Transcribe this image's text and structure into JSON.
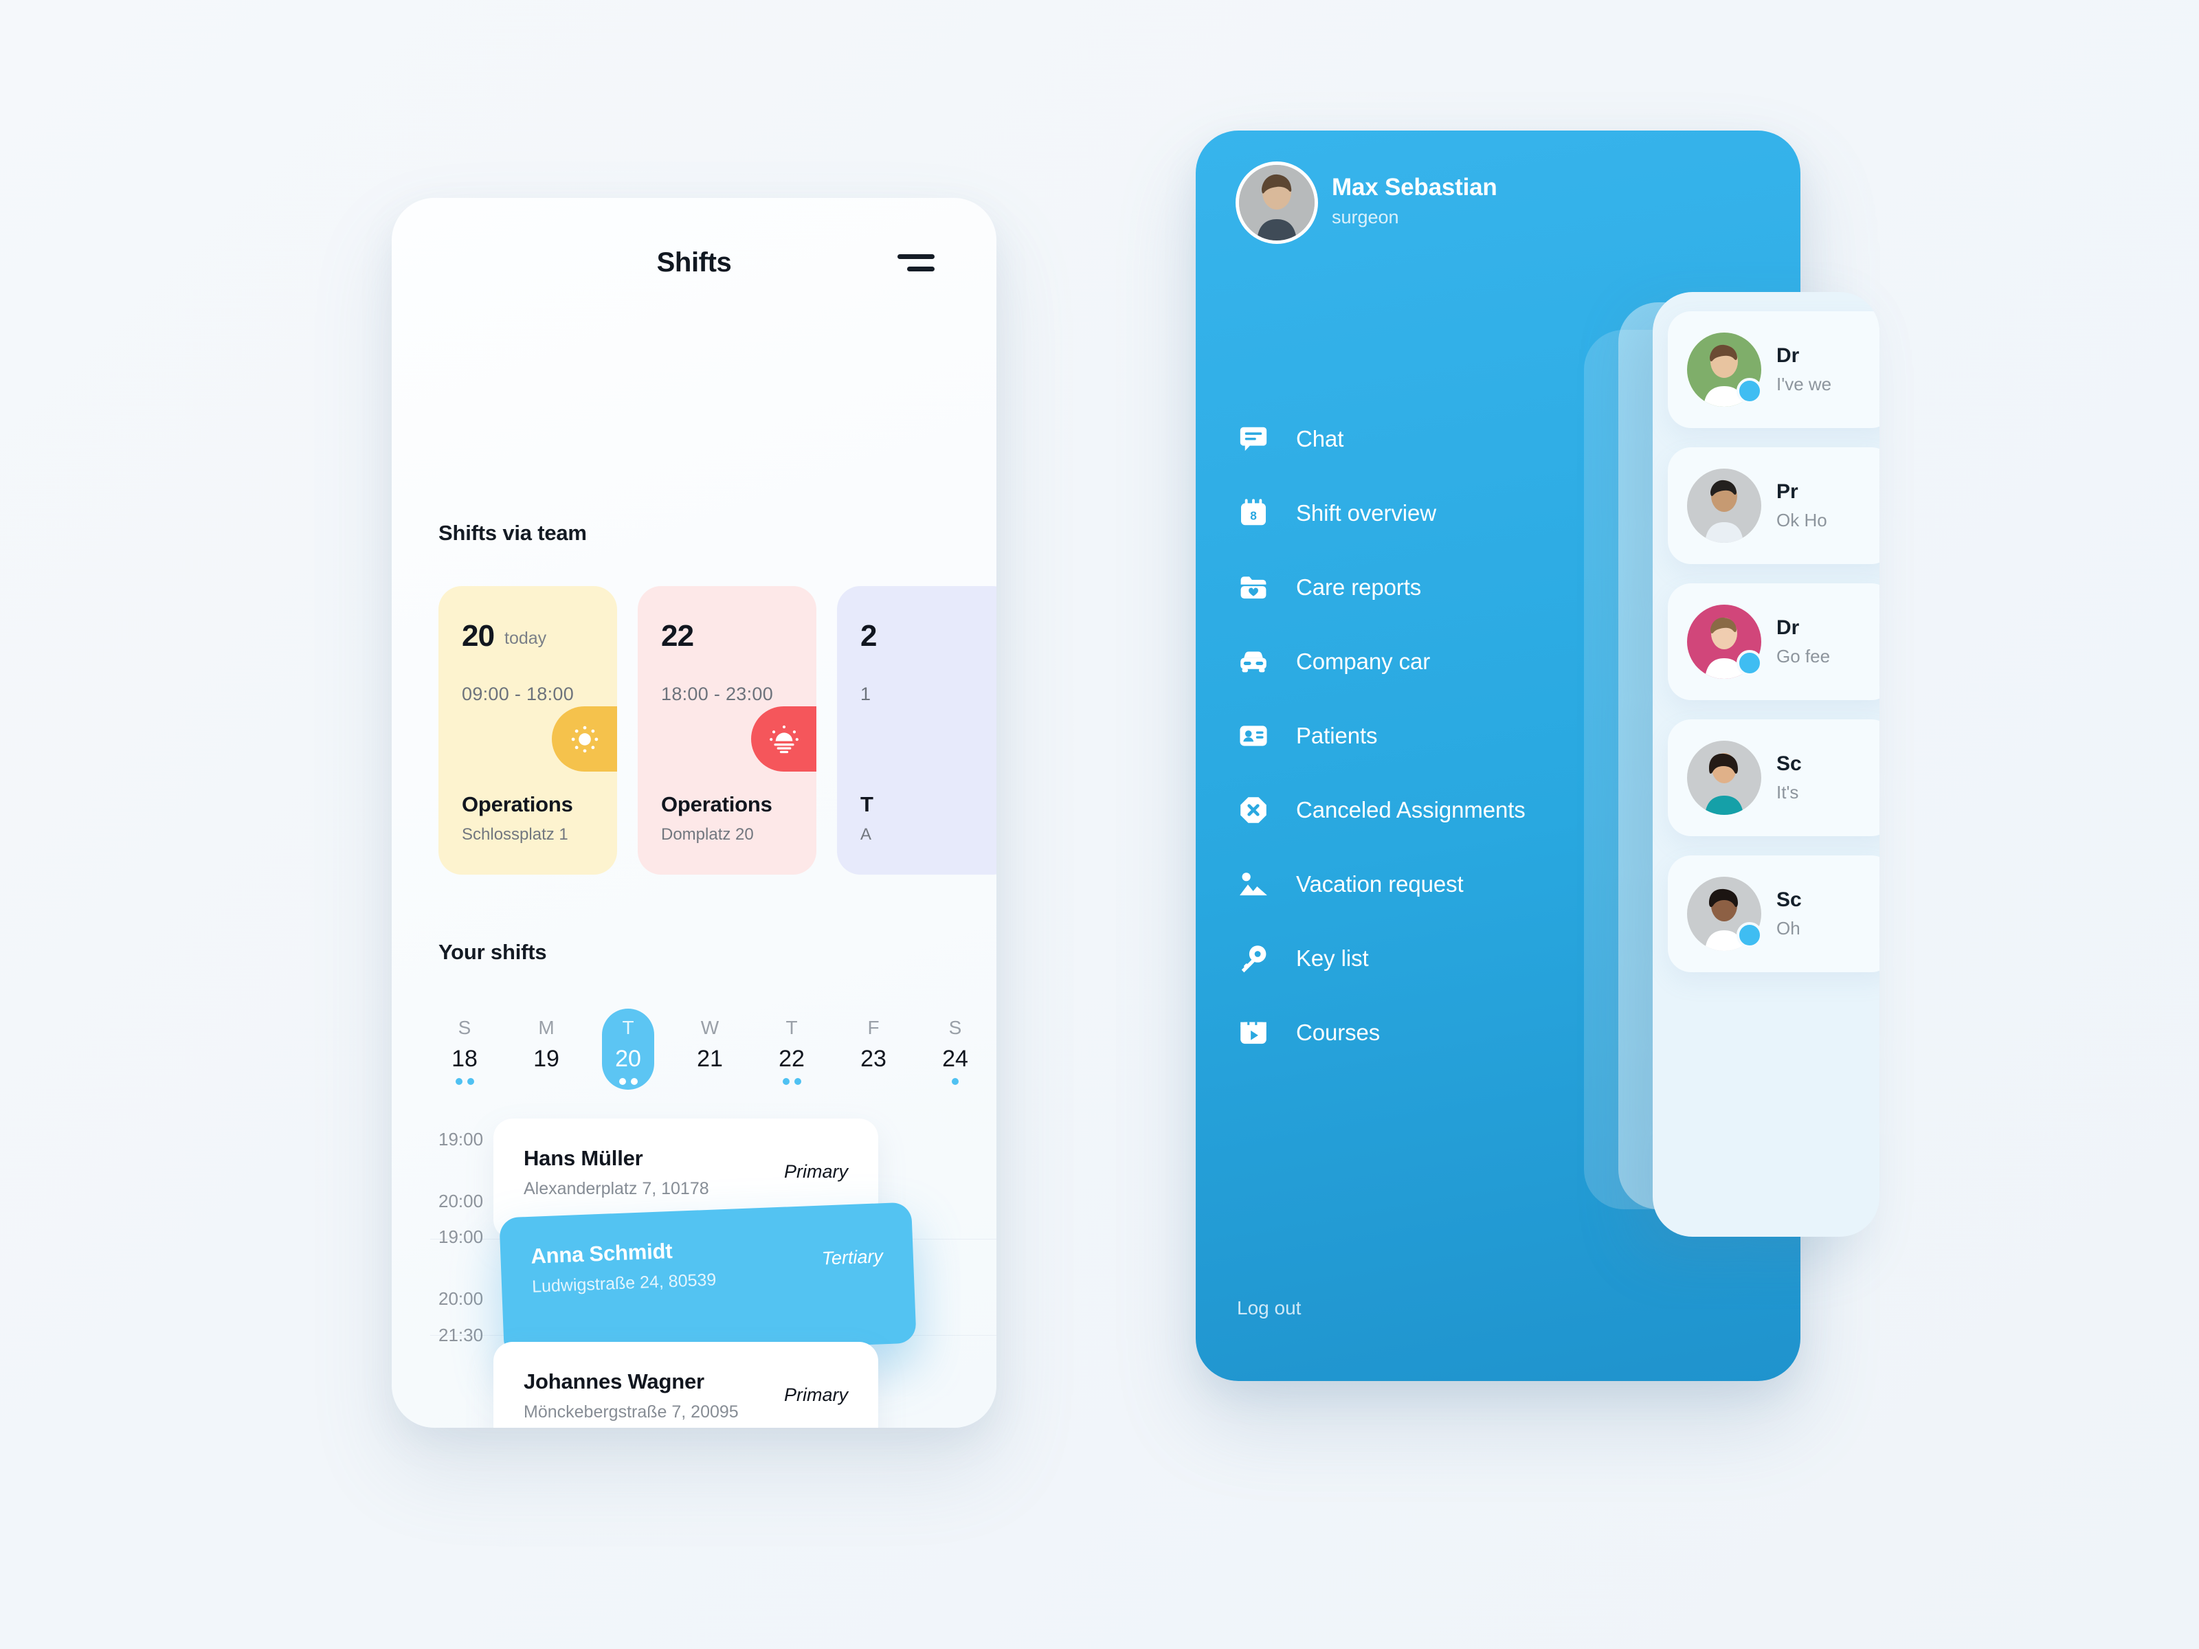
{
  "shifts_screen": {
    "title": "Shifts",
    "menu_icon": "hamburger-icon",
    "team_section_title": "Shifts via team",
    "your_section_title": "Your shifts",
    "team_cards": [
      {
        "day": "20",
        "today_label": "today",
        "time": "09:00 - 18:00",
        "department": "Operations",
        "address": "Schlossplatz 1",
        "badge_icon": "sun-icon",
        "badge_color": "#F5C24C",
        "card_color": "#FDF3CF"
      },
      {
        "day": "22",
        "today_label": "",
        "time": "18:00 - 23:00",
        "department": "Operations",
        "address": "Domplatz 20",
        "badge_icon": "sunset-icon",
        "badge_color": "#F5565B",
        "card_color": "#FDE8E8"
      },
      {
        "day": "2",
        "today_label": "",
        "time": "1",
        "department": "T",
        "address": "A",
        "badge_icon": "moon-icon",
        "badge_color": "#7E8BE0",
        "card_color": "#E7EAFB"
      }
    ],
    "days": [
      {
        "dow": "S",
        "num": "18",
        "dots": 2,
        "selected": false
      },
      {
        "dow": "M",
        "num": "19",
        "dots": 0,
        "selected": false
      },
      {
        "dow": "T",
        "num": "20",
        "dots": 2,
        "selected": true
      },
      {
        "dow": "W",
        "num": "21",
        "dots": 0,
        "selected": false
      },
      {
        "dow": "T",
        "num": "22",
        "dots": 2,
        "selected": false
      },
      {
        "dow": "F",
        "num": "23",
        "dots": 0,
        "selected": false
      },
      {
        "dow": "S",
        "num": "24",
        "dots": 1,
        "selected": false
      }
    ],
    "timeline_labels": [
      "19:00",
      "20:00",
      "19:00",
      "20:00",
      "21:30"
    ],
    "appointments": [
      {
        "name": "Hans Müller",
        "address": "Alexanderplatz 7, 10178",
        "role": "Primary",
        "highlighted": false
      },
      {
        "name": "Anna Schmidt",
        "address": "Ludwigstraße 24, 80539",
        "role": "Tertiary",
        "highlighted": true
      },
      {
        "name": "Johannes Wagner",
        "address": "Mönckebergstraße 7, 20095",
        "role": "Primary",
        "highlighted": false
      }
    ]
  },
  "menu_screen": {
    "profile": {
      "name": "Max Sebastian",
      "role": "surgeon",
      "avatar": "user-avatar"
    },
    "items": [
      {
        "label": "Chat",
        "icon": "chat-bubble-icon"
      },
      {
        "label": "Shift overview",
        "icon": "calendar-icon"
      },
      {
        "label": "Care reports",
        "icon": "folder-heart-icon"
      },
      {
        "label": "Company car",
        "icon": "car-icon"
      },
      {
        "label": "Patients",
        "icon": "id-card-icon"
      },
      {
        "label": "Canceled Assignments",
        "icon": "x-octagon-icon"
      },
      {
        "label": "Vacation request",
        "icon": "landscape-icon"
      },
      {
        "label": "Key list",
        "icon": "key-icon"
      },
      {
        "label": "Courses",
        "icon": "video-play-icon"
      }
    ],
    "logout_label": "Log out",
    "accent_color": "#2AA8E0"
  },
  "chat_drawer": {
    "items": [
      {
        "name": "Dr",
        "message": "I've we",
        "online": true,
        "avatar_bg": "#7FAE6A"
      },
      {
        "name": "Pr",
        "message": "Ok Ho",
        "online": false,
        "avatar_bg": "#C9CCCE"
      },
      {
        "name": "Dr",
        "message": "Go fee",
        "online": true,
        "avatar_bg": "#D1467A"
      },
      {
        "name": "Sc",
        "message": "It's",
        "online": false,
        "avatar_bg": "#C9CCCE"
      },
      {
        "name": "Sc",
        "message": "Oh",
        "online": true,
        "avatar_bg": "#C9CCCE"
      }
    ]
  }
}
